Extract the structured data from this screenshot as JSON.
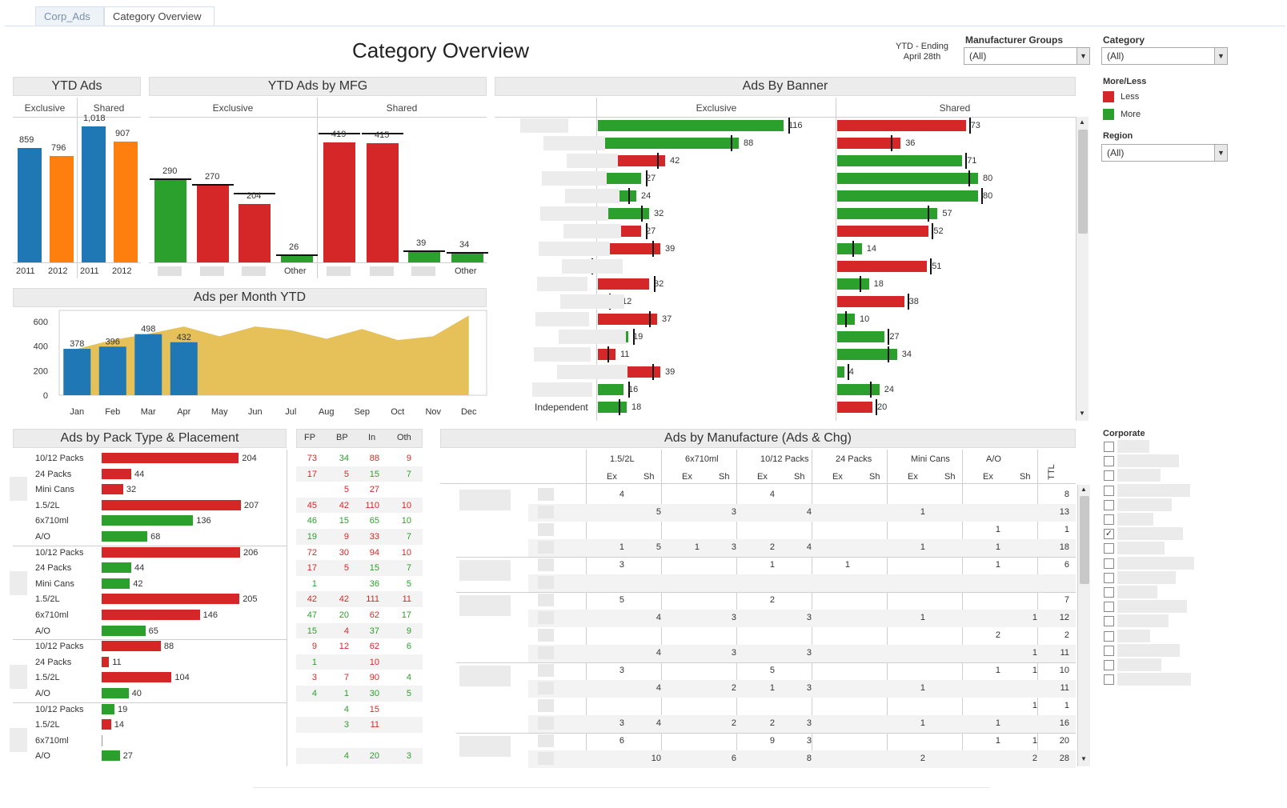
{
  "tabs": [
    {
      "label": "Corp_Ads"
    },
    {
      "label": "Category Overview"
    }
  ],
  "title": "Category Overview",
  "ytd_note": {
    "line1": "YTD - Ending",
    "line2": "April 28th"
  },
  "filters": {
    "mfg_groups": {
      "label": "Manufacturer Groups",
      "value": "(All)"
    },
    "category": {
      "label": "Category",
      "value": "(All)"
    },
    "region": {
      "label": "Region",
      "value": "(All)"
    }
  },
  "legend": {
    "title": "More/Less",
    "less": "Less",
    "more": "More",
    "less_color": "#d62728",
    "more_color": "#2ca02c"
  },
  "corporate": {
    "title": "Corporate",
    "checked_index": 6,
    "count": 17
  },
  "ytd_ads": {
    "title": "YTD Ads",
    "groups": [
      "Exclusive",
      "Shared"
    ],
    "bars": [
      {
        "year": "2011",
        "value": 859,
        "label": "859"
      },
      {
        "year": "2012",
        "value": 796,
        "label": "796"
      },
      {
        "year": "2011",
        "value": 1018,
        "label": "1,018"
      },
      {
        "year": "2012",
        "value": 907,
        "label": "907"
      }
    ]
  },
  "ytd_mfg": {
    "title": "YTD Ads by MFG",
    "groups": [
      "Exclusive",
      "Shared"
    ],
    "bars": [
      {
        "value": 290,
        "ref": 290,
        "color": "green",
        "label": "290",
        "x": ""
      },
      {
        "value": 270,
        "ref": 270,
        "color": "red",
        "label": "270",
        "x": ""
      },
      {
        "value": 204,
        "ref": 240,
        "color": "red",
        "label": "204",
        "x": ""
      },
      {
        "value": 26,
        "ref": 26,
        "color": "green",
        "label": "26",
        "x": "Other"
      },
      {
        "value": 419,
        "ref": 450,
        "color": "red",
        "label": "419",
        "x": ""
      },
      {
        "value": 415,
        "ref": 450,
        "color": "red",
        "label": "415",
        "x": ""
      },
      {
        "value": 39,
        "ref": 39,
        "color": "green",
        "label": "39",
        "x": ""
      },
      {
        "value": 34,
        "ref": 34,
        "color": "green",
        "label": "34",
        "x": "Other"
      }
    ]
  },
  "ads_per_month": {
    "title": "Ads per Month YTD",
    "yticks": [
      "600",
      "400",
      "200",
      "0"
    ],
    "months": [
      "Jan",
      "Feb",
      "Mar",
      "Apr",
      "May",
      "Jun",
      "Jul",
      "Aug",
      "Sep",
      "Oct",
      "Nov",
      "Dec"
    ],
    "bars": [
      {
        "value": 378,
        "label": "378"
      },
      {
        "value": 396,
        "label": "396"
      },
      {
        "value": 498,
        "label": "498"
      },
      {
        "value": 432,
        "label": "432"
      }
    ],
    "area": [
      378,
      450,
      500,
      560,
      480,
      560,
      530,
      460,
      540,
      450,
      480,
      650
    ]
  },
  "ads_by_banner": {
    "title": "Ads By Banner",
    "groups": [
      "Exclusive",
      "Shared"
    ],
    "last_row_label": "Independent",
    "exclusive": [
      {
        "v": 116,
        "c": "green",
        "t": "116"
      },
      {
        "v": 88,
        "c": "green",
        "t": "88"
      },
      {
        "v": 42,
        "c": "red",
        "t": "42"
      },
      {
        "v": 27,
        "c": "green",
        "t": "27"
      },
      {
        "v": 24,
        "c": "green",
        "t": "24"
      },
      {
        "v": 32,
        "c": "green",
        "t": "32"
      },
      {
        "v": 27,
        "c": "red",
        "t": "27"
      },
      {
        "v": 39,
        "c": "red",
        "t": "39"
      },
      {
        "v": 1,
        "c": "green",
        "t": "1"
      },
      {
        "v": 32,
        "c": "red",
        "t": "32"
      },
      {
        "v": 12,
        "c": "red",
        "t": "12"
      },
      {
        "v": 37,
        "c": "red",
        "t": "37"
      },
      {
        "v": 19,
        "c": "green",
        "t": "19"
      },
      {
        "v": 11,
        "c": "red",
        "t": "11"
      },
      {
        "v": 39,
        "c": "red",
        "t": "39"
      },
      {
        "v": 16,
        "c": "green",
        "t": "16"
      },
      {
        "v": 18,
        "c": "green",
        "t": "18"
      }
    ],
    "shared": [
      {
        "v": 73,
        "c": "red",
        "t": "73"
      },
      {
        "v": 36,
        "c": "red",
        "t": "36"
      },
      {
        "v": 71,
        "c": "green",
        "t": "71"
      },
      {
        "v": 80,
        "c": "green",
        "t": "80"
      },
      {
        "v": 80,
        "c": "green",
        "t": "80"
      },
      {
        "v": 57,
        "c": "green",
        "t": "57"
      },
      {
        "v": 52,
        "c": "red",
        "t": "52"
      },
      {
        "v": 14,
        "c": "green",
        "t": "14"
      },
      {
        "v": 51,
        "c": "red",
        "t": "51"
      },
      {
        "v": 18,
        "c": "green",
        "t": "18"
      },
      {
        "v": 38,
        "c": "red",
        "t": "38"
      },
      {
        "v": 10,
        "c": "green",
        "t": "10"
      },
      {
        "v": 27,
        "c": "green",
        "t": "27"
      },
      {
        "v": 34,
        "c": "green",
        "t": "34"
      },
      {
        "v": 4,
        "c": "green",
        "t": "4"
      },
      {
        "v": 24,
        "c": "green",
        "t": "24"
      },
      {
        "v": 20,
        "c": "red",
        "t": "20"
      }
    ]
  },
  "pack_type": {
    "title": "Ads by Pack Type & Placement",
    "rows": [
      {
        "pack": "10/12 Packs",
        "v": 204,
        "c": "red",
        "t": "204"
      },
      {
        "pack": "24 Packs",
        "v": 44,
        "c": "red",
        "t": "44"
      },
      {
        "pack": "Mini Cans",
        "v": 32,
        "c": "red",
        "t": "32"
      },
      {
        "pack": "1.5/2L",
        "v": 207,
        "c": "red",
        "t": "207"
      },
      {
        "pack": "6x710ml",
        "v": 136,
        "c": "green",
        "t": "136"
      },
      {
        "pack": "A/O",
        "v": 68,
        "c": "green",
        "t": "68"
      },
      {
        "pack": "10/12 Packs",
        "v": 206,
        "c": "red",
        "t": "206"
      },
      {
        "pack": "24 Packs",
        "v": 44,
        "c": "green",
        "t": "44"
      },
      {
        "pack": "Mini Cans",
        "v": 42,
        "c": "green",
        "t": "42"
      },
      {
        "pack": "1.5/2L",
        "v": 205,
        "c": "red",
        "t": "205"
      },
      {
        "pack": "6x710ml",
        "v": 146,
        "c": "red",
        "t": "146"
      },
      {
        "pack": "A/O",
        "v": 65,
        "c": "green",
        "t": "65"
      },
      {
        "pack": "10/12 Packs",
        "v": 88,
        "c": "red",
        "t": "88"
      },
      {
        "pack": "24 Packs",
        "v": 11,
        "c": "red",
        "t": "11"
      },
      {
        "pack": "1.5/2L",
        "v": 104,
        "c": "red",
        "t": "104"
      },
      {
        "pack": "A/O",
        "v": 40,
        "c": "green",
        "t": "40"
      },
      {
        "pack": "10/12 Packs",
        "v": 19,
        "c": "green",
        "t": "19"
      },
      {
        "pack": "1.5/2L",
        "v": 14,
        "c": "red",
        "t": "14"
      },
      {
        "pack": "6x710ml",
        "v": 0,
        "c": "green",
        "t": ""
      },
      {
        "pack": "A/O",
        "v": 27,
        "c": "green",
        "t": "27"
      }
    ]
  },
  "placement": {
    "headers": [
      "FP",
      "BP",
      "In",
      "Oth"
    ],
    "rows": [
      [
        [
          "73",
          "r"
        ],
        [
          "34",
          "g"
        ],
        [
          "88",
          "r"
        ],
        [
          "9",
          "r"
        ]
      ],
      [
        [
          "17",
          "r"
        ],
        [
          "5",
          "r"
        ],
        [
          "15",
          "g"
        ],
        [
          "7",
          "g"
        ]
      ],
      [
        [
          "",
          ""
        ],
        [
          "5",
          "r"
        ],
        [
          "27",
          "r"
        ],
        [
          "",
          ""
        ]
      ],
      [
        [
          "45",
          "r"
        ],
        [
          "42",
          "r"
        ],
        [
          "110",
          "r"
        ],
        [
          "10",
          "r"
        ]
      ],
      [
        [
          "46",
          "g"
        ],
        [
          "15",
          "g"
        ],
        [
          "65",
          "g"
        ],
        [
          "10",
          "g"
        ]
      ],
      [
        [
          "19",
          "g"
        ],
        [
          "9",
          "r"
        ],
        [
          "33",
          "r"
        ],
        [
          "7",
          "g"
        ]
      ],
      [
        [
          "72",
          "r"
        ],
        [
          "30",
          "r"
        ],
        [
          "94",
          "r"
        ],
        [
          "10",
          "r"
        ]
      ],
      [
        [
          "17",
          "r"
        ],
        [
          "5",
          "r"
        ],
        [
          "15",
          "g"
        ],
        [
          "7",
          "g"
        ]
      ],
      [
        [
          "1",
          "g"
        ],
        [
          "",
          ""
        ],
        [
          "36",
          "g"
        ],
        [
          "5",
          "g"
        ]
      ],
      [
        [
          "42",
          "r"
        ],
        [
          "42",
          "r"
        ],
        [
          "111",
          "r"
        ],
        [
          "11",
          "r"
        ]
      ],
      [
        [
          "47",
          "g"
        ],
        [
          "20",
          "g"
        ],
        [
          "62",
          "r"
        ],
        [
          "17",
          "g"
        ]
      ],
      [
        [
          "15",
          "g"
        ],
        [
          "4",
          "r"
        ],
        [
          "37",
          "g"
        ],
        [
          "9",
          "g"
        ]
      ],
      [
        [
          "9",
          "r"
        ],
        [
          "12",
          "r"
        ],
        [
          "62",
          "r"
        ],
        [
          "6",
          "g"
        ]
      ],
      [
        [
          "1",
          "g"
        ],
        [
          "",
          ""
        ],
        [
          "10",
          "r"
        ],
        [
          "",
          ""
        ]
      ],
      [
        [
          "3",
          "r"
        ],
        [
          "7",
          "r"
        ],
        [
          "90",
          "r"
        ],
        [
          "4",
          "g"
        ]
      ],
      [
        [
          "4",
          "g"
        ],
        [
          "1",
          "g"
        ],
        [
          "30",
          "g"
        ],
        [
          "5",
          "g"
        ]
      ],
      [
        [
          "",
          ""
        ],
        [
          "4",
          "g"
        ],
        [
          "15",
          "r"
        ],
        [
          "",
          ""
        ]
      ],
      [
        [
          "",
          ""
        ],
        [
          "3",
          "g"
        ],
        [
          "11",
          "r"
        ],
        [
          "",
          ""
        ]
      ],
      [
        [
          "",
          ""
        ],
        [
          "",
          ""
        ],
        [
          "",
          ""
        ],
        [
          "",
          ""
        ]
      ],
      [
        [
          "",
          ""
        ],
        [
          "4",
          "g"
        ],
        [
          "20",
          "g"
        ],
        [
          "3",
          "g"
        ]
      ]
    ]
  },
  "manufacture": {
    "title": "Ads by Manufacture (Ads & Chg)",
    "groups": [
      "1.5/2L",
      "6x710ml",
      "10/12 Packs",
      "24 Packs",
      "Mini Cans",
      "A/O"
    ],
    "sub": [
      "Ex",
      "Sh"
    ],
    "total": "TTL",
    "rows": [
      [
        "4",
        "",
        "",
        "",
        "4",
        "",
        "",
        "",
        "",
        "",
        "",
        "",
        "8"
      ],
      [
        "",
        "5",
        "",
        "3",
        "",
        "4",
        "",
        "",
        "1",
        "",
        "",
        "",
        "13"
      ],
      [
        "",
        "",
        "",
        "",
        "",
        "",
        "",
        "",
        "",
        "",
        "1",
        "",
        "1"
      ],
      [
        "1",
        "5",
        "1",
        "3",
        "2",
        "4",
        "",
        "",
        "1",
        "",
        "1",
        "",
        "18"
      ],
      [
        "3",
        "",
        "",
        "",
        "1",
        "",
        "1",
        "",
        "",
        "",
        "1",
        "",
        "6"
      ],
      [
        "",
        "",
        "",
        "",
        "",
        "",
        "",
        "",
        "",
        "",
        "",
        "",
        ""
      ],
      [
        "5",
        "",
        "",
        "",
        "2",
        "",
        "",
        "",
        "",
        "",
        "",
        "",
        "7"
      ],
      [
        "",
        "4",
        "",
        "3",
        "",
        "3",
        "",
        "",
        "1",
        "",
        "",
        "1",
        "12"
      ],
      [
        "",
        "",
        "",
        "",
        "",
        "",
        "",
        "",
        "",
        "",
        "2",
        "",
        "2"
      ],
      [
        "",
        "4",
        "",
        "3",
        "",
        "3",
        "",
        "",
        "",
        "",
        "",
        "1",
        "11"
      ],
      [
        "3",
        "",
        "",
        "",
        "5",
        "",
        "",
        "",
        "",
        "",
        "1",
        "1",
        "10"
      ],
      [
        "",
        "4",
        "",
        "2",
        "1",
        "3",
        "",
        "",
        "1",
        "",
        "",
        "",
        "11"
      ],
      [
        "",
        "",
        "",
        "",
        "",
        "",
        "",
        "",
        "",
        "",
        "",
        "1",
        "1"
      ],
      [
        "3",
        "4",
        "",
        "2",
        "2",
        "3",
        "",
        "",
        "1",
        "",
        "1",
        "",
        "16"
      ],
      [
        "6",
        "",
        "",
        "",
        "9",
        "3",
        "",
        "",
        "",
        "",
        "1",
        "1",
        "20"
      ],
      [
        "",
        "10",
        "",
        "6",
        "",
        "8",
        "",
        "",
        "2",
        "",
        "",
        "2",
        "28"
      ]
    ]
  }
}
